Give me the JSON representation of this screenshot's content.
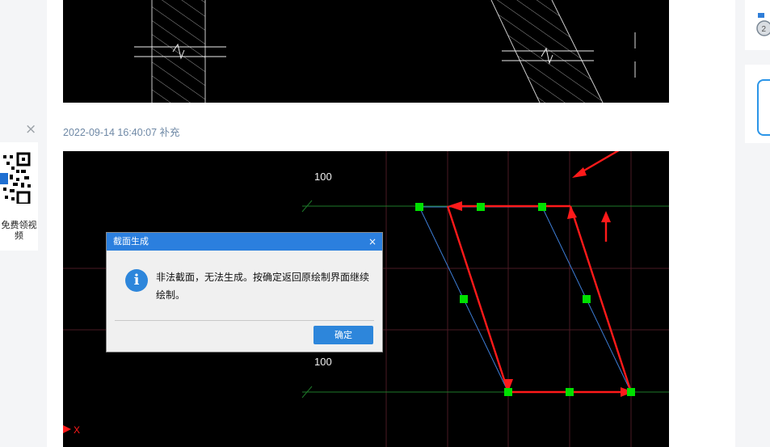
{
  "post": {
    "supplement_timestamp": "2022-09-14 16:40:07 补充"
  },
  "left_promo": {
    "close_label": "×",
    "text": "免费领视频"
  },
  "cad": {
    "dim_label_top": "100",
    "dim_label_bottom": "100",
    "axis_label": "X"
  },
  "dialog": {
    "title": "截面生成",
    "close_label": "×",
    "info_glyph": "i",
    "message": "非法截面，无法生成。按确定返回原绘制界面继续绘制。",
    "ok_label": "确定"
  },
  "colors": {
    "accent_blue": "#2b7fde",
    "annotation_red": "#ff1a1a",
    "grip_green": "#00ff00",
    "timestamp": "#6f89a6"
  },
  "icons": {
    "dialog_info": "info-icon",
    "dialog_close": "close-icon",
    "promo_close": "close-icon",
    "qr": "qr-code-icon",
    "medal": "medal-icon"
  }
}
